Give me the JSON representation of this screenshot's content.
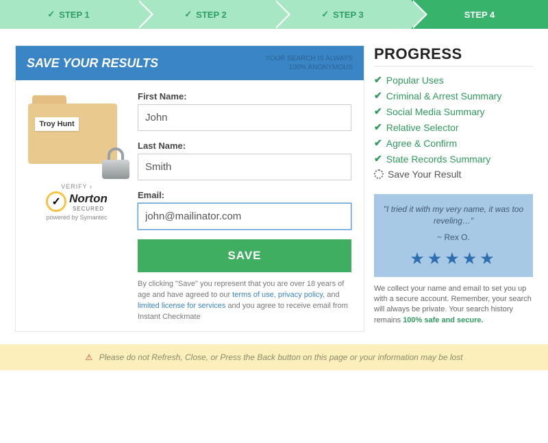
{
  "stepper": [
    {
      "label": "STEP 1",
      "done": true
    },
    {
      "label": "STEP 2",
      "done": true
    },
    {
      "label": "STEP 3",
      "done": true
    },
    {
      "label": "STEP 4",
      "active": true
    }
  ],
  "card": {
    "title": "SAVE YOUR RESULTS",
    "anon_line1": "YOUR SEARCH IS ALWAYS",
    "anon_line2": "100% ANONYMOUS",
    "folder_name": "Troy Hunt",
    "norton": {
      "verify": "VERIFY ›",
      "name": "Norton",
      "secured": "SECURED",
      "powered": "powered by Symantec"
    }
  },
  "form": {
    "first_label": "First Name:",
    "first_value": "John",
    "last_label": "Last Name:",
    "last_value": "Smith",
    "email_label": "Email:",
    "email_value": "john@mailinator.com",
    "save_label": "SAVE",
    "disclaimer_pre": "By clicking \"Save\" you represent that you are over 18 years of age and have agreed to our ",
    "terms": "terms of use",
    "privacy": "privacy policy",
    "limited": "limited license for services",
    "disclaimer_post": " and you agree to receive email from Instant Checkmate"
  },
  "progress": {
    "title": "PROGRESS",
    "items": [
      {
        "label": "Popular Uses",
        "done": true
      },
      {
        "label": "Criminal & Arrest Summary",
        "done": true
      },
      {
        "label": "Social Media Summary",
        "done": true
      },
      {
        "label": "Relative Selector",
        "done": true
      },
      {
        "label": "Agree & Confirm",
        "done": true
      },
      {
        "label": "State Records Summary",
        "done": true
      },
      {
        "label": "Save Your Result",
        "done": false
      }
    ]
  },
  "testimonial": {
    "quote": "\"I tried it with my very name, it was too reveling…\"",
    "author": "~ Rex O."
  },
  "note": {
    "text": "We collect your name and email to set you up with a secure account. Remember, your search will always be private. Your search history remains ",
    "bold": "100% safe and secure."
  },
  "warning": "Please do not Refresh, Close, or Press the Back button on this page or your information may be lost"
}
